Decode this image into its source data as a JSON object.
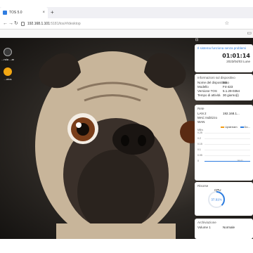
{
  "browser": {
    "tab_title": "TOS 5.0",
    "new_tab_symbol": "+",
    "close_symbol": "×",
    "url_host": "192.168.1.101",
    "url_path": ":5181/tos/#/desktop",
    "back_symbol": "←",
    "forward_symbol": "→",
    "reload_symbol": "↻",
    "bookmark_symbol": "☆"
  },
  "desktop": {
    "icons": [
      {
        "label": "...nda\n...ar",
        "color": "#3a3a3a"
      },
      {
        "label": "...otos",
        "color": "#f3a712"
      }
    ]
  },
  "panel": {
    "collapse_symbol": "⊡",
    "system_status": "Il sistema funziona senza problemi",
    "clock": "01:01:14",
    "date": "2023/04/03 Lune",
    "device_info": {
      "title": "Informazioni sul dispositivo",
      "rows": [
        {
          "k": "Nome del dispositivo",
          "v": "Sitio"
        },
        {
          "k": "Modello",
          "v": "F4-423"
        },
        {
          "k": "Versione TOS",
          "v": "5.1.29-0354"
        },
        {
          "k": "Tempo di attività",
          "v": "30 giorno(i)"
        }
      ]
    },
    "network": {
      "title": "Rete",
      "rows": [
        {
          "k": "LAN 2",
          "v": "192.168.1..."
        },
        {
          "k": "MAC Indirizzo",
          "v": ""
        },
        {
          "k": "WAN",
          "v": ""
        }
      ],
      "legend_up": "Upstream",
      "legend_down": "Do...",
      "up_color": "#f39c12",
      "down_color": "#2d7de0"
    },
    "chart_data": {
      "type": "line",
      "ylabel": "MB/s",
      "y_ticks": [
        "0.25",
        "0.2",
        "0.15",
        "0.1",
        "0.05",
        "0"
      ],
      "x_ticks": [
        "18:01"
      ],
      "series": [
        {
          "name": "Upstream",
          "values": [
            0,
            0,
            0,
            0
          ]
        },
        {
          "name": "Do...",
          "values": [
            0,
            0,
            0,
            0
          ]
        }
      ]
    },
    "resources": {
      "title": "Risorse",
      "cpu_label": "CPU",
      "cpu_percent": 37.91,
      "cpu_text": "37.91%"
    },
    "storage": {
      "title": "Archiviazione",
      "row_k": "Volume 1",
      "row_v": "Normale"
    }
  }
}
